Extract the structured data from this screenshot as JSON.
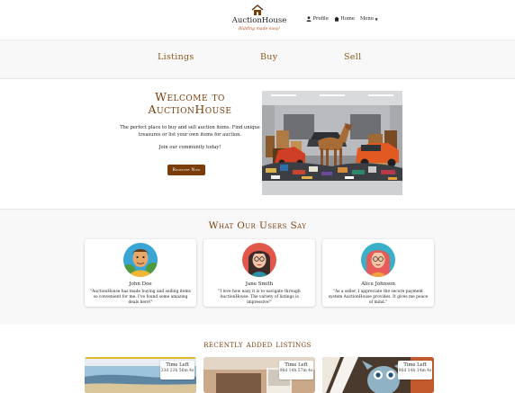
{
  "header": {
    "brand": "AuctionHouse",
    "tagline": "Bidding made easy!",
    "nav": {
      "profile": "Profile",
      "home": "Home",
      "menu": "Menu"
    }
  },
  "tabs": [
    "Listings",
    "Buy",
    "Sell"
  ],
  "hero": {
    "title_line1": "Welcome to",
    "title_line2": "AuctionHouse",
    "description": "The perfect place to buy and sell auction items. Find unique treasures or list your own items for auction.",
    "community": "Join our community today!",
    "register_label": "Register Now"
  },
  "testimonials": {
    "title": "What Our Users Say",
    "items": [
      {
        "name": "John Doe",
        "quote": "\"AuctionHouse has made buying and selling items so convenient for me. I've found some amazing deals here!\""
      },
      {
        "name": "Jane Smith",
        "quote": "\"I love how easy it is to navigate through AuctionHouse. The variety of listings is impressive!\""
      },
      {
        "name": "Alice Johnson",
        "quote": "\"As a seller, I appreciate the secure payment system AuctionHouse provides. It gives me peace of mind.\""
      }
    ]
  },
  "recent": {
    "title": "recently added Listings",
    "items": [
      {
        "time_label": "Time Left",
        "time_value": "33d 23h 56m 4s"
      },
      {
        "time_label": "Time Left",
        "time_value": "96d 14h 57m 4s"
      },
      {
        "time_label": "Time Left",
        "time_value": "96d 14h 14m 4s"
      }
    ]
  },
  "colors": {
    "accent": "#7a3d0a",
    "tab_text": "#8a5a1a",
    "tagline": "#b5541c",
    "band_background": "#f8f8f8"
  }
}
